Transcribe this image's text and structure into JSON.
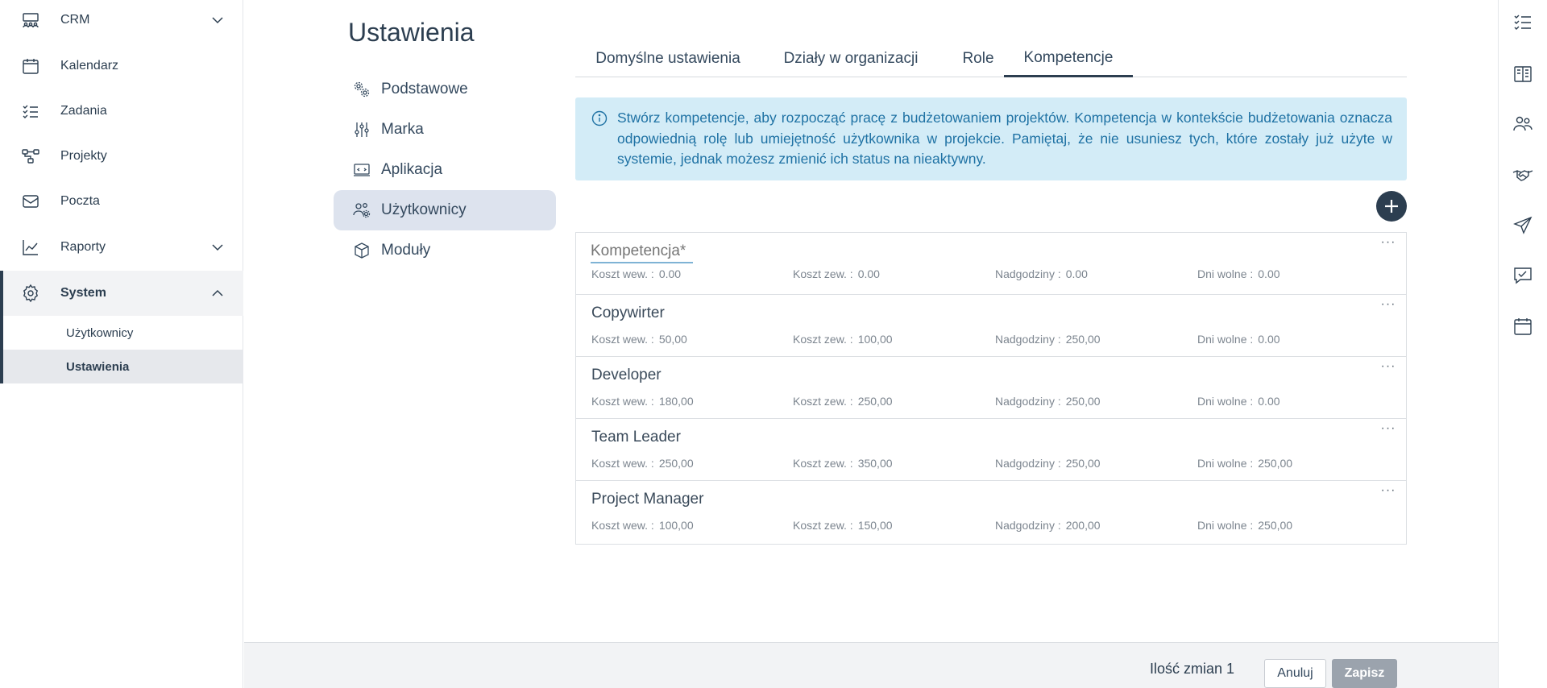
{
  "sidebar": {
    "items": [
      {
        "label": "CRM",
        "icon": "crm-icon"
      },
      {
        "label": "Kalendarz",
        "icon": "calendar-icon"
      },
      {
        "label": "Zadania",
        "icon": "tasks-icon"
      },
      {
        "label": "Projekty",
        "icon": "projects-icon"
      },
      {
        "label": "Poczta",
        "icon": "mail-icon"
      },
      {
        "label": "Raporty",
        "icon": "chart-icon"
      },
      {
        "label": "System",
        "icon": "gear-icon"
      }
    ],
    "subitems": [
      {
        "label": "Użytkownicy"
      },
      {
        "label": "Ustawienia"
      }
    ]
  },
  "page": {
    "title": "Ustawienia"
  },
  "settings_nav": [
    {
      "label": "Podstawowe",
      "icon": "gears-icon"
    },
    {
      "label": "Marka",
      "icon": "sliders-icon"
    },
    {
      "label": "Aplikacja",
      "icon": "app-window-icon"
    },
    {
      "label": "Użytkownicy",
      "icon": "users-gear-icon"
    },
    {
      "label": "Moduły",
      "icon": "cube-icon"
    }
  ],
  "tabs": [
    {
      "label": "Domyślne ustawienia"
    },
    {
      "label": "Działy w organizacji"
    },
    {
      "label": "Role"
    },
    {
      "label": "Kompetencje"
    }
  ],
  "info": {
    "text": "Stwórz kompetencje, aby rozpocząć pracę z budżetowaniem projektów. Kompetencja w kontekście budżetowania oznacza odpowiednią rolę lub umiejętność użytkownika w projekcie. Pamiętaj, że nie usuniesz tych, które zostały już użyte w systemie, jednak możesz zmienić ich status na nieaktywny."
  },
  "competencies": {
    "new_placeholder": "Kompetencja*",
    "field_labels": {
      "internal": "Koszt wew. :",
      "external": "Koszt zew. :",
      "overtime": "Nadgodziny :",
      "days_off": "Dni wolne :"
    },
    "more_label": "···",
    "rows": [
      {
        "name": "",
        "internal": "0.00",
        "external": "0.00",
        "overtime": "0.00",
        "days_off": "0.00"
      },
      {
        "name": "Copywirter",
        "internal": "50,00",
        "external": "100,00",
        "overtime": "250,00",
        "days_off": "0.00"
      },
      {
        "name": "Developer",
        "internal": "180,00",
        "external": "250,00",
        "overtime": "250,00",
        "days_off": "0.00"
      },
      {
        "name": "Team Leader",
        "internal": "250,00",
        "external": "350,00",
        "overtime": "250,00",
        "days_off": "250,00"
      },
      {
        "name": "Project Manager",
        "internal": "100,00",
        "external": "150,00",
        "overtime": "200,00",
        "days_off": "250,00"
      }
    ]
  },
  "footer": {
    "changes": "Ilość zmian 1",
    "cancel": "Anuluj",
    "save": "Zapisz"
  },
  "rail": [
    {
      "icon": "checklist-icon"
    },
    {
      "icon": "book-icon"
    },
    {
      "icon": "people-icon"
    },
    {
      "icon": "handshake-icon"
    },
    {
      "icon": "send-icon"
    },
    {
      "icon": "chat-check-icon"
    },
    {
      "icon": "calendar-icon"
    }
  ],
  "colors": {
    "primary": "#2c3e50",
    "info_bg": "#d3ecf7",
    "info_text": "#1f72a4",
    "active_nav_bg": "#dde3ee"
  }
}
